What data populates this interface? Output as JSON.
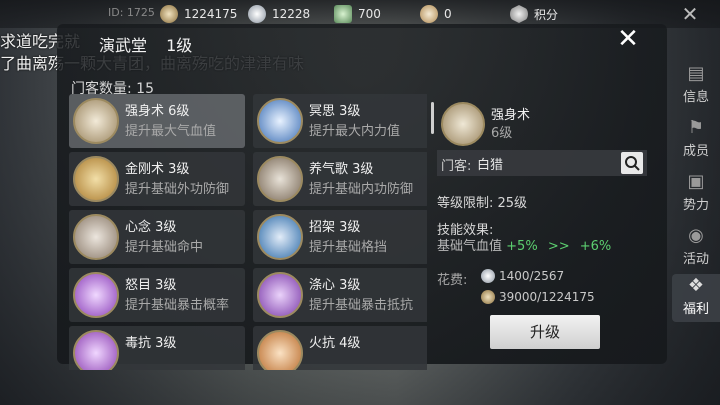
{
  "topbar": {
    "player_id": "ID: 1725",
    "resources": [
      {
        "icon": "coin-icon",
        "value": "1224175"
      },
      {
        "icon": "silver-ingot-icon",
        "value": "12228"
      },
      {
        "icon": "jade-icon",
        "value": "700"
      },
      {
        "icon": "rice-bowl-icon",
        "value": "0"
      },
      {
        "icon": "points-badge-icon",
        "value": "积分"
      }
    ]
  },
  "chat": {
    "line1": "求道吃完就",
    "line2": "了曲离殇一颗大青团，曲离殇吃的津津有味"
  },
  "sidebar": {
    "items": [
      {
        "label": "信息",
        "icon": "info-icon"
      },
      {
        "label": "成员",
        "icon": "members-icon"
      },
      {
        "label": "势力",
        "icon": "faction-icon"
      },
      {
        "label": "活动",
        "icon": "activity-icon"
      },
      {
        "label": "福利",
        "icon": "welfare-icon"
      }
    ]
  },
  "dialog": {
    "title": "演武堂",
    "level": "1级",
    "disciple_count": "门客数量: 15",
    "skills": [
      {
        "name": "强身术 6级",
        "desc": "提升最大气血值",
        "color": "#c8b17a",
        "selected": true
      },
      {
        "name": "冥思 3级",
        "desc": "提升最大内力值",
        "color": "#3d6fb4"
      },
      {
        "name": "金刚术 3级",
        "desc": "提升基础外功防御",
        "color": "#a97a2e"
      },
      {
        "name": "养气歌 3级",
        "desc": "提升基础内功防御",
        "color": "#7a6a58"
      },
      {
        "name": "心念 3级",
        "desc": "提升基础命中",
        "color": "#8a7a6a"
      },
      {
        "name": "招架 3级",
        "desc": "提升基础格挡",
        "color": "#2d6ba8"
      },
      {
        "name": "怒目 3级",
        "desc": "提升基础暴击概率",
        "color": "#8a3fb8"
      },
      {
        "name": "涤心 3级",
        "desc": "提升基础暴击抵抗",
        "color": "#7a3aa8"
      },
      {
        "name": "毒抗 3级",
        "desc": "",
        "color": "#8a3fb0"
      },
      {
        "name": "火抗 4级",
        "desc": "",
        "color": "#b86a2a"
      }
    ],
    "detail": {
      "name": "强身术",
      "level": "6级",
      "disciple_label": "门客:",
      "disciple_value": "白猎",
      "level_limit": "等级限制: 25级",
      "effect_title": "技能效果:",
      "effect_base": "基础气血值",
      "effect_from": "+5%",
      "effect_arrow": ">>",
      "effect_to": "+6%",
      "cost_title": "花费:",
      "cost1": "1400/2567",
      "cost2": "39000/1224175",
      "upgrade_label": "升级"
    }
  }
}
